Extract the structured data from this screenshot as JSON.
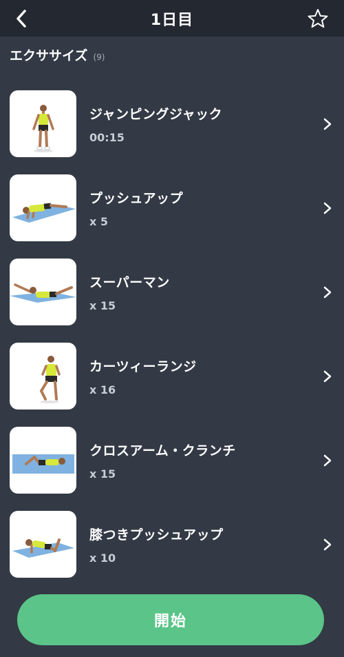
{
  "header": {
    "title": "1日目",
    "back_icon": "chevron-left-icon",
    "favorite_icon": "star-outline-icon"
  },
  "section": {
    "title": "エクササイズ",
    "count": "(9)"
  },
  "exercises": [
    {
      "name": "ジャンピングジャック",
      "detail": "00:15",
      "pose": "standing"
    },
    {
      "name": "プッシュアップ",
      "detail": "x 5",
      "pose": "pushup"
    },
    {
      "name": "スーパーマン",
      "detail": "x 15",
      "pose": "superman"
    },
    {
      "name": "カーツィーランジ",
      "detail": "x 16",
      "pose": "lunge"
    },
    {
      "name": "クロスアーム・クランチ",
      "detail": "x 15",
      "pose": "crunch"
    },
    {
      "name": "膝つきプッシュアップ",
      "detail": "x 10",
      "pose": "knee-pushup"
    }
  ],
  "start_button": {
    "label": "開始"
  },
  "colors": {
    "background": "#333945",
    "topbar": "#242830",
    "accent": "#5bc488",
    "mat": "#7fb2e0",
    "shirt": "#d6e83a"
  }
}
